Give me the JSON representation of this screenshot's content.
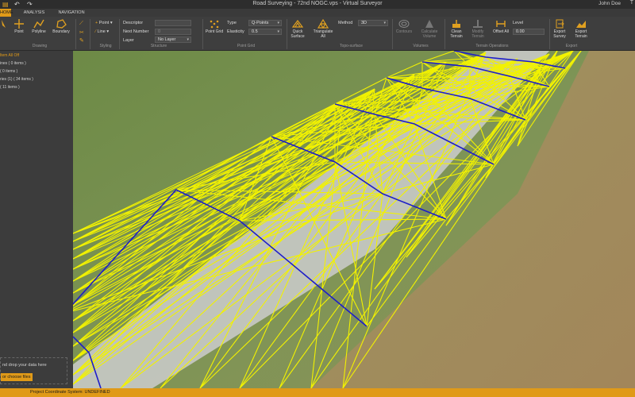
{
  "window": {
    "title": "Road Surveying - 72nd NOGC.vps - Virtual Surveyor",
    "user": "John Doe",
    "user_button": "T"
  },
  "tabs": [
    {
      "label": "HOME",
      "active": true
    },
    {
      "label": "ANALYSIS",
      "active": false
    },
    {
      "label": "NAVIGATION",
      "active": false
    }
  ],
  "ribbon": {
    "drawing": {
      "label": "Drawing",
      "point": "Point",
      "polyline": "Polyline",
      "boundary": "Boundary"
    },
    "styling": {
      "label": "Styling",
      "point": "Point",
      "line": "Line"
    },
    "structure": {
      "label": "Structure",
      "descriptor": "Descriptor",
      "next_number": "Next Number",
      "next_number_value": "0",
      "layer": "Layer",
      "layer_value": "No Layer"
    },
    "point_grid": {
      "label": "Point Grid",
      "button": "Point Grid",
      "type_label": "Type",
      "type_value": "Q-Points",
      "elasticity_label": "Elasticity",
      "elasticity_value": "0.5"
    },
    "topo": {
      "label": "Topo-surface",
      "quick_surface": "Quick Surface",
      "triangulate_all": "Triangulate All",
      "method_label": "Method",
      "method_value": "3D"
    },
    "volumes": {
      "label": "Volumes",
      "contours": "Contours",
      "calculate_volume": "Calculate Volume"
    },
    "terrain_ops": {
      "label": "Terrain Operations",
      "clean_terrain": "Clean Terrain",
      "modify_terrain": "Modify Terrain",
      "offset_all": "Offset All",
      "level_label": "Level",
      "level_value": "0.00"
    },
    "export": {
      "label": "Export",
      "export_survey": "Export Survey",
      "export_terrain": "Export Terrain"
    }
  },
  "left_panel": {
    "items": [
      {
        "label": "ltem All Off",
        "highlight": true
      },
      {
        "label": "ines ( 0 items )",
        "highlight": false
      },
      {
        "label": "( 0 items )",
        "highlight": false
      },
      {
        "label": "ries (1) ( 34 items )",
        "highlight": false
      },
      {
        "label": "( 11 items )",
        "highlight": false
      }
    ],
    "drop_text": "nd drop your data here",
    "choose_files": "or choose files"
  },
  "status": {
    "text": "Project Coordinate System:  UNDEFINED"
  },
  "colors": {
    "accent": "#e09a18",
    "triangulation": "#f2f200",
    "breaklines": "#1d1dc8",
    "grass": "#6f8a4a",
    "dirt": "#a08858",
    "road": "#c8cac6"
  }
}
